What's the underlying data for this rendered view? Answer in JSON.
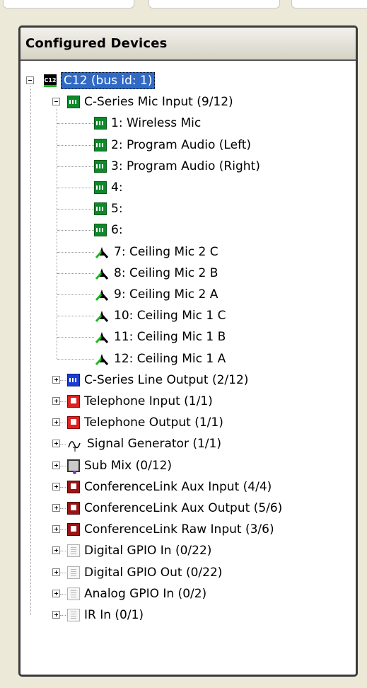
{
  "panel": {
    "title": "Configured Devices"
  },
  "tree": {
    "root": {
      "label": "C12 (bus id: 1)",
      "icon": "c12-chip-icon",
      "chip_text": "C12"
    },
    "mic_group": {
      "label": "C-Series Mic Input (9/12)",
      "icon": "mic-input-icon"
    },
    "mic_items": [
      {
        "label": "1: Wireless Mic",
        "icon": "mic-input-icon"
      },
      {
        "label": "2: Program Audio (Left)",
        "icon": "mic-input-icon"
      },
      {
        "label": "3: Program Audio (Right)",
        "icon": "mic-input-icon"
      },
      {
        "label": "4:",
        "icon": "mic-input-icon"
      },
      {
        "label": "5:",
        "icon": "mic-input-icon"
      },
      {
        "label": "6:",
        "icon": "mic-input-icon"
      },
      {
        "label": "7: Ceiling Mic 2 C",
        "icon": "ceiling-mic-icon"
      },
      {
        "label": "8: Ceiling Mic 2 B",
        "icon": "ceiling-mic-icon"
      },
      {
        "label": "9: Ceiling Mic 2 A",
        "icon": "ceiling-mic-icon"
      },
      {
        "label": "10: Ceiling Mic 1 C",
        "icon": "ceiling-mic-icon"
      },
      {
        "label": "11: Ceiling Mic 1 B",
        "icon": "ceiling-mic-icon"
      },
      {
        "label": "12: Ceiling Mic 1 A",
        "icon": "ceiling-mic-icon"
      }
    ],
    "groups": [
      {
        "label": "C-Series Line Output (2/12)",
        "icon": "line-output-icon"
      },
      {
        "label": "Telephone Input (1/1)",
        "icon": "telephone-icon"
      },
      {
        "label": "Telephone Output (1/1)",
        "icon": "telephone-icon"
      },
      {
        "label": "Signal Generator (1/1)",
        "icon": "signal-generator-icon"
      },
      {
        "label": "Sub Mix (0/12)",
        "icon": "sub-mix-icon"
      },
      {
        "label": "ConferenceLink Aux Input (4/4)",
        "icon": "conferencelink-icon"
      },
      {
        "label": "ConferenceLink Aux Output (5/6)",
        "icon": "conferencelink-icon"
      },
      {
        "label": "ConferenceLink Raw Input (3/6)",
        "icon": "conferencelink-icon"
      },
      {
        "label": "Digital GPIO In (0/22)",
        "icon": "gpio-icon"
      },
      {
        "label": "Digital GPIO Out (0/22)",
        "icon": "gpio-icon"
      },
      {
        "label": "Analog GPIO In (0/2)",
        "icon": "gpio-icon"
      },
      {
        "label": "IR In (0/1)",
        "icon": "gpio-icon"
      }
    ]
  },
  "colors": {
    "selection": "#316ac5",
    "mic_green": "#0c8a2a",
    "line_blue": "#1a3ccf",
    "tel_red": "#e02020",
    "conf_red": "#9a1414"
  }
}
